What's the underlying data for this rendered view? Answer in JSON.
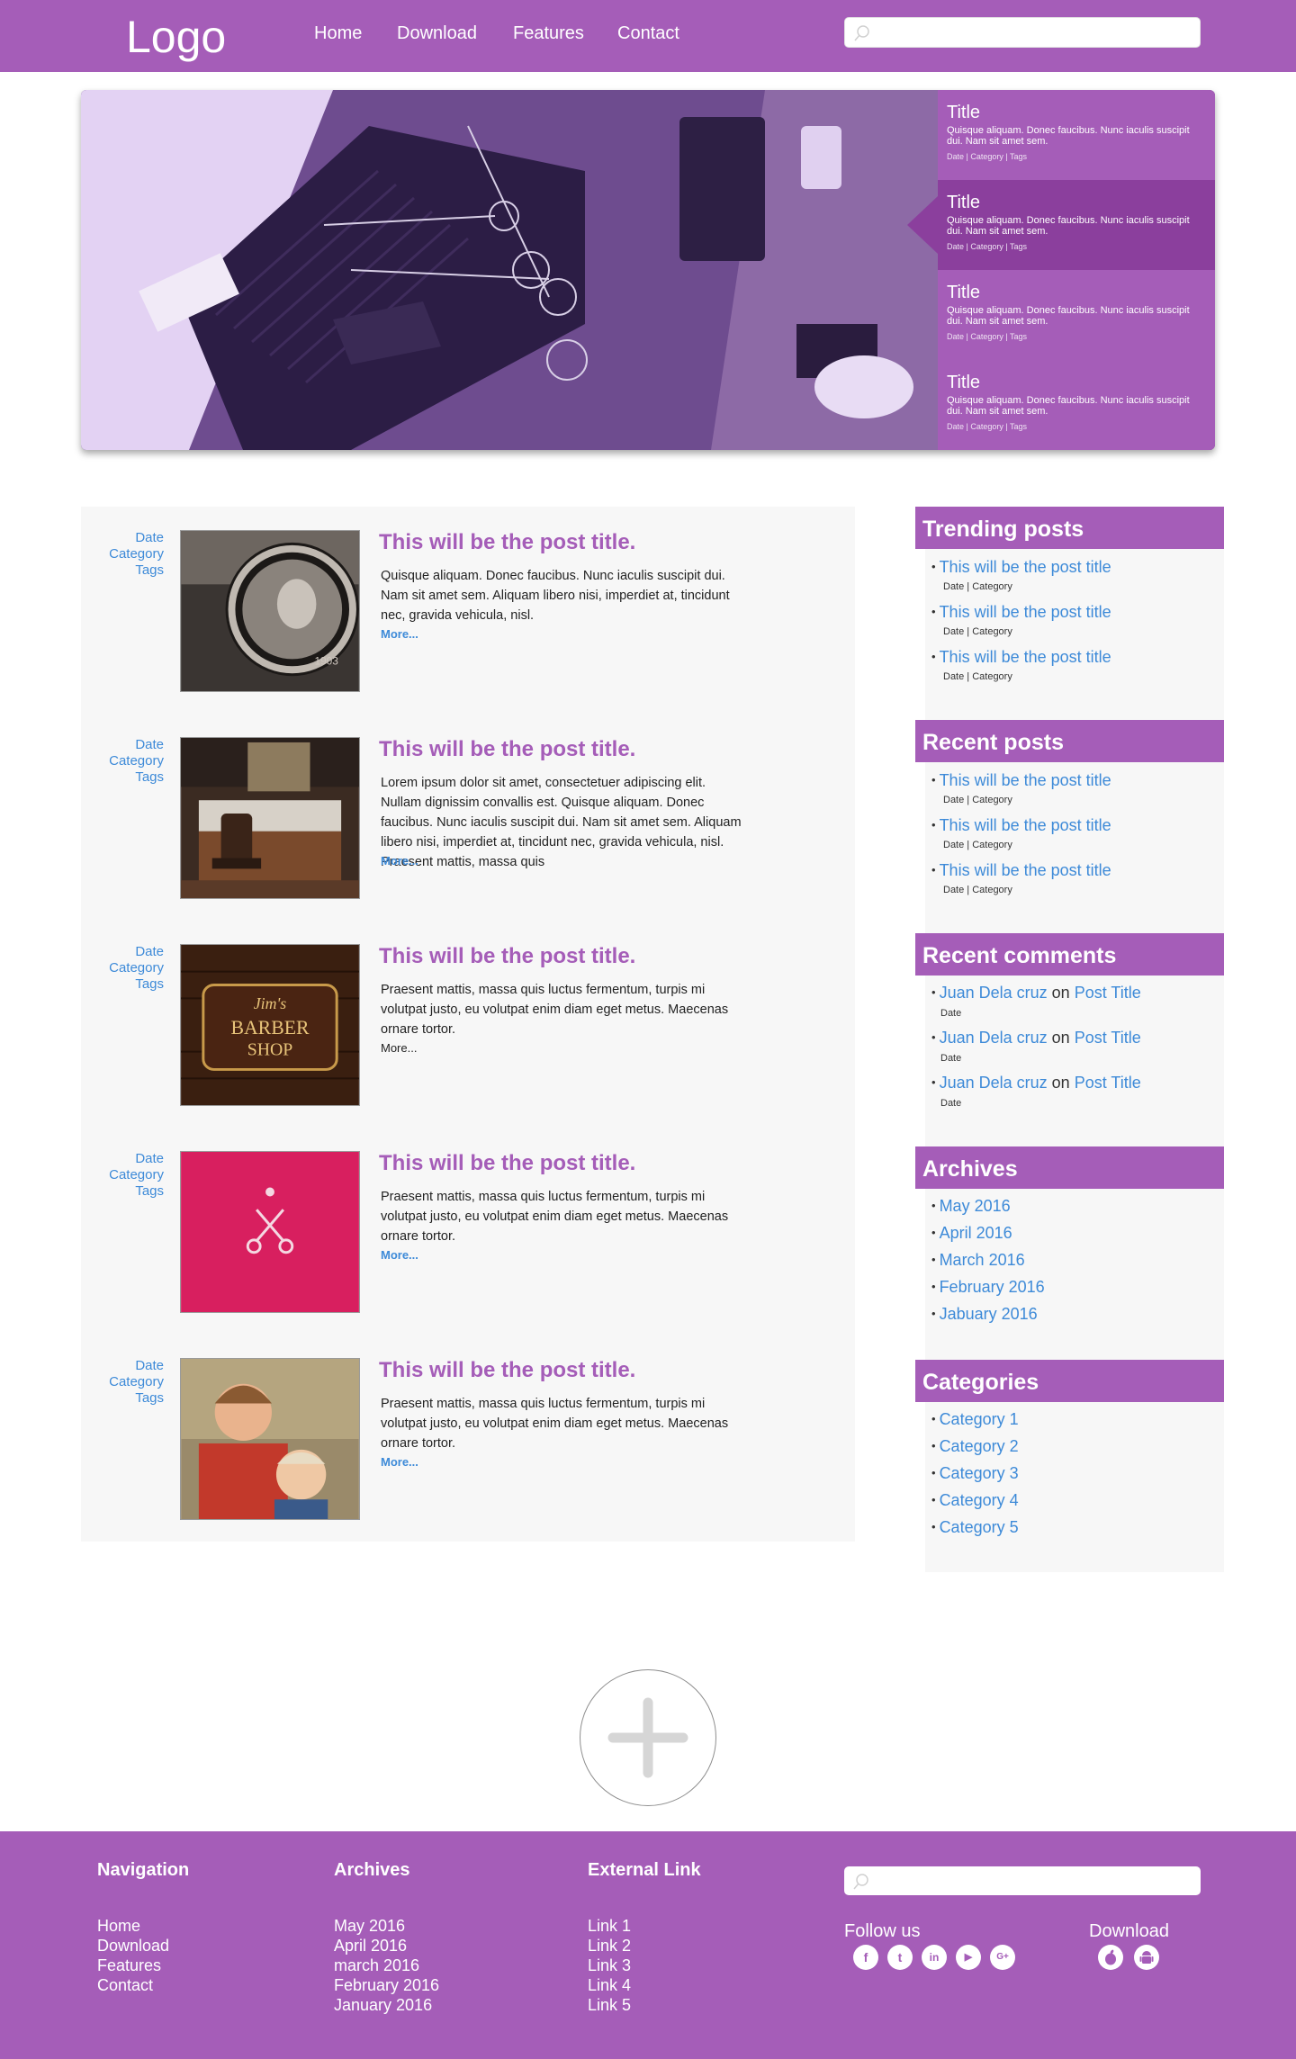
{
  "header": {
    "logo": "Logo",
    "nav": [
      "Home",
      "Download",
      "Features",
      "Contact"
    ]
  },
  "hero": {
    "items": [
      {
        "title": "Title",
        "desc": "Quisque aliquam. Donec faucibus. Nunc iaculis suscipit dui. Nam sit amet sem.",
        "meta": "Date | Category | Tags"
      },
      {
        "title": "Title",
        "desc": "Quisque aliquam. Donec faucibus. Nunc iaculis suscipit dui. Nam sit amet sem.",
        "meta": "Date | Category | Tags"
      },
      {
        "title": "Title",
        "desc": "Quisque aliquam. Donec faucibus. Nunc iaculis suscipit dui. Nam sit amet sem.",
        "meta": "Date | Category | Tags"
      },
      {
        "title": "Title",
        "desc": "Quisque aliquam. Donec faucibus. Nunc iaculis suscipit dui. Nam sit amet sem.",
        "meta": "Date | Category | Tags"
      }
    ]
  },
  "posts": [
    {
      "date": "Date",
      "category": "Category",
      "tags": "Tags",
      "title": "This will be the post title.",
      "text": "Quisque aliquam. Donec faucibus. Nunc iaculis suscipit dui. Nam sit amet sem. Aliquam libero nisi, imperdiet at, tincidunt nec, gravida vehicula, nisl.",
      "more": "More..."
    },
    {
      "date": "Date",
      "category": "Category",
      "tags": "Tags",
      "title": "This will be the post title.",
      "text": "Lorem ipsum dolor sit amet, consectetuer adipiscing elit. Nullam dignissim convallis est. Quisque aliquam. Donec faucibus. Nunc iaculis suscipit dui. Nam sit amet sem. Aliquam libero nisi, imperdiet at, tincidunt nec, gravida vehicula, nisl. Praesent mattis, massa quis",
      "more": "More..."
    },
    {
      "date": "Date",
      "category": "Category",
      "tags": "Tags",
      "title": "This will be the post title.",
      "text": "Praesent mattis, massa quis luctus fermentum, turpis mi volutpat justo, eu volutpat enim diam eget metus. Maecenas ornare tortor.",
      "more": "More..."
    },
    {
      "date": "Date",
      "category": "Category",
      "tags": "Tags",
      "title": "This will be the post title.",
      "text": "Praesent mattis, massa quis luctus fermentum, turpis mi volutpat justo, eu volutpat enim diam eget metus. Maecenas ornare tortor.",
      "more": "More..."
    },
    {
      "date": "Date",
      "category": "Category",
      "tags": "Tags",
      "title": "This will be the post title.",
      "text": "Praesent mattis, massa quis luctus fermentum, turpis mi volutpat justo, eu volutpat enim diam eget metus. Maecenas ornare tortor.",
      "more": "More..."
    }
  ],
  "barbershop_sign": {
    "line1": "Jim's",
    "line2": "BARBER",
    "line3": "SHOP"
  },
  "coin": {
    "year": "1903"
  },
  "sidebar": {
    "trending": {
      "title": "Trending posts",
      "items": [
        {
          "label": "This will be the post title",
          "meta": "Date | Category"
        },
        {
          "label": "This will be the post title",
          "meta": "Date | Category"
        },
        {
          "label": "This will be the post title",
          "meta": "Date | Category"
        }
      ]
    },
    "recent": {
      "title": "Recent posts",
      "items": [
        {
          "label": "This will be the post title",
          "meta": "Date | Category"
        },
        {
          "label": "This will be the post title",
          "meta": "Date | Category"
        },
        {
          "label": "This will be the post title",
          "meta": "Date | Category"
        }
      ]
    },
    "comments": {
      "title": "Recent comments",
      "items": [
        {
          "author": "Juan Dela cruz",
          "on": "on",
          "post": "Post Title",
          "meta": "Date"
        },
        {
          "author": "Juan Dela cruz",
          "on": "on",
          "post": "Post Title",
          "meta": "Date"
        },
        {
          "author": "Juan Dela cruz",
          "on": "on",
          "post": "Post Title",
          "meta": "Date"
        }
      ]
    },
    "archives": {
      "title": "Archives",
      "items": [
        "May 2016",
        "April 2016",
        "March 2016",
        "February 2016",
        "Jabuary 2016"
      ]
    },
    "categories": {
      "title": "Categories",
      "items": [
        "Category 1",
        "Category 2",
        "Category 3",
        "Category 4",
        "Category 5"
      ]
    }
  },
  "footer": {
    "navigation": {
      "title": "Navigation",
      "links": [
        "Home",
        "Download",
        "Features",
        "Contact"
      ]
    },
    "archives": {
      "title": "Archives",
      "links": [
        "May 2016",
        "April 2016",
        "march 2016",
        "February 2016",
        "January 2016"
      ]
    },
    "external": {
      "title": "External Link",
      "links": [
        "Link 1",
        "Link 2",
        "Link 3",
        "Link 4",
        "Link 5"
      ]
    },
    "follow_label": "Follow us",
    "download_label": "Download",
    "social_icons": [
      "facebook-icon",
      "twitter-icon",
      "linkedin-icon",
      "youtube-icon",
      "google-plus-icon"
    ],
    "app_icons": [
      "apple-icon",
      "android-icon"
    ]
  },
  "colors": {
    "primary": "#a55db8",
    "primary_dark": "#8b3f9d",
    "link": "#3d8ad8",
    "panel": "#f7f7f7"
  }
}
